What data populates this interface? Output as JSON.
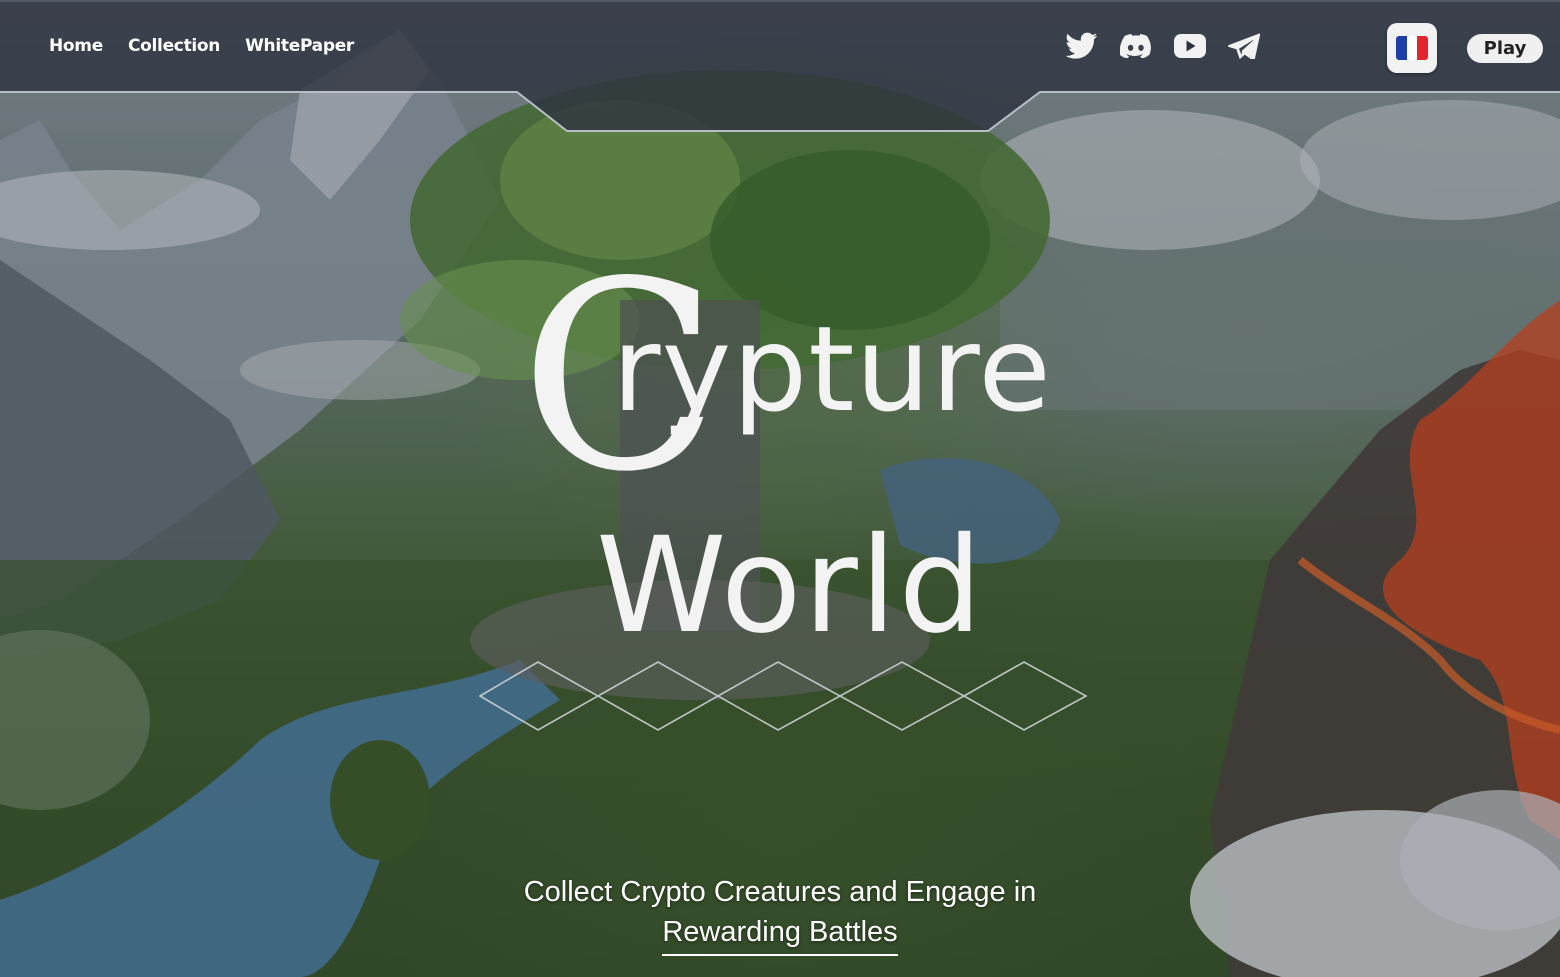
{
  "nav": {
    "links": [
      {
        "label": "Home"
      },
      {
        "label": "Collection"
      },
      {
        "label": "WhitePaper"
      }
    ],
    "socials": [
      {
        "icon": "twitter-icon"
      },
      {
        "icon": "discord-icon"
      },
      {
        "icon": "youtube-icon"
      },
      {
        "icon": "telegram-icon"
      }
    ],
    "language": {
      "icon": "france-flag-icon",
      "colors": [
        "#1f3fa8",
        "#ffffff",
        "#e1262d"
      ]
    },
    "play_label": "Play"
  },
  "hero": {
    "title_initial": "C",
    "title_rest": "rypture",
    "title_line2": "World",
    "tagline_line1": "Collect Crypto Creatures and Engage in",
    "tagline_line2": "Rewarding Battles"
  },
  "colors": {
    "navbar_bg": "#2e3340",
    "text": "#ffffff",
    "lava": "#e0481c"
  }
}
